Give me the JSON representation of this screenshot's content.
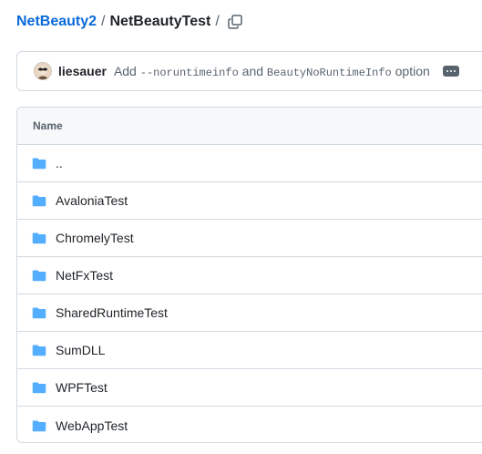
{
  "breadcrumb": {
    "repo": "NetBeauty2",
    "separator": "/",
    "folder": "NetBeautyTest",
    "trailing": "/"
  },
  "commit": {
    "author": "liesauer",
    "message_pre": "Add ",
    "code1": "--noruntimeinfo",
    "message_mid": " and ",
    "code2": "BeautyNoRuntimeInfo",
    "message_post": " option"
  },
  "table": {
    "header": "Name",
    "rows": [
      {
        "name": "..",
        "type": "parent"
      },
      {
        "name": "AvaloniaTest",
        "type": "folder"
      },
      {
        "name": "ChromelyTest",
        "type": "folder"
      },
      {
        "name": "NetFxTest",
        "type": "folder"
      },
      {
        "name": "SharedRuntimeTest",
        "type": "folder"
      },
      {
        "name": "SumDLL",
        "type": "folder"
      },
      {
        "name": "WPFTest",
        "type": "folder"
      },
      {
        "name": "WebAppTest",
        "type": "folder"
      }
    ]
  },
  "colors": {
    "link": "#0969da",
    "folder": "#54aeff",
    "muted": "#59636e",
    "border": "#d1d9e0"
  },
  "icons": [
    "copy-icon",
    "ellipsis-icon",
    "folder-icon"
  ]
}
